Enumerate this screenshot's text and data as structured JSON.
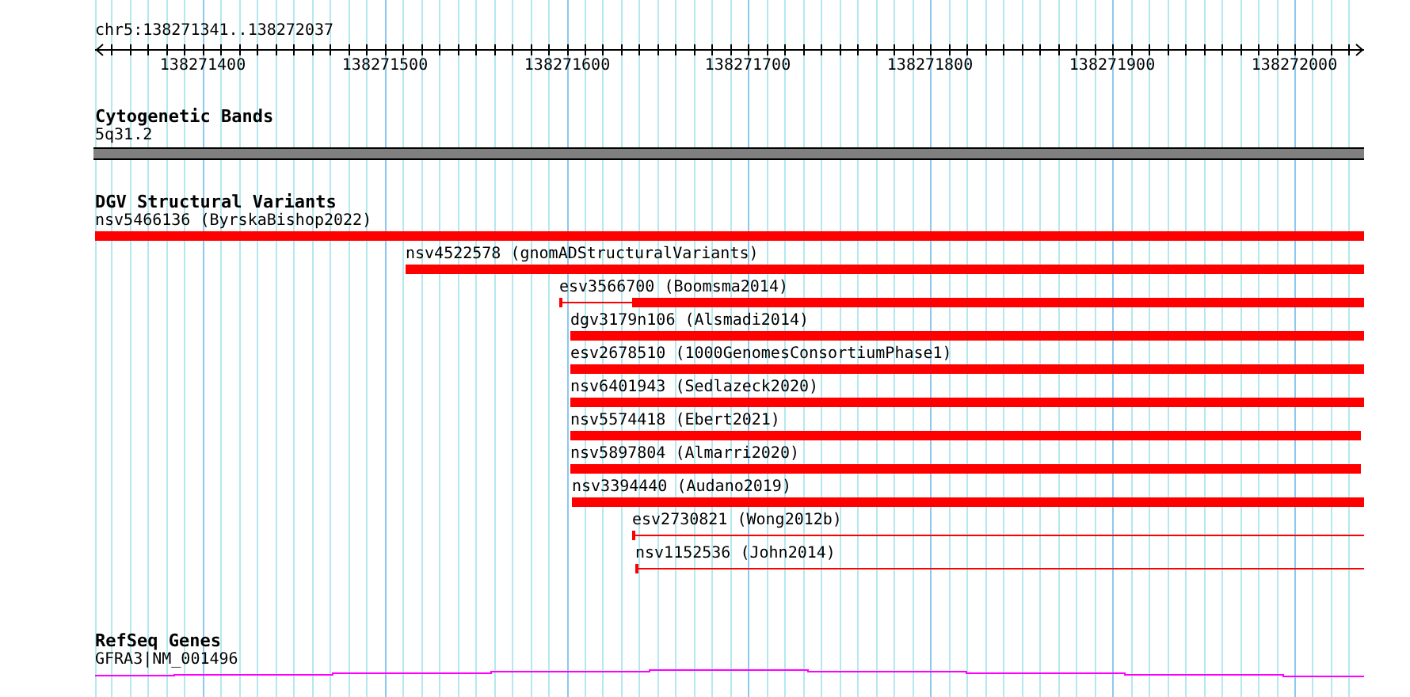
{
  "location": "chr5:138271341..138272037",
  "axis": {
    "ticks": [
      "138271400",
      "138271500",
      "138271600",
      "138271700",
      "138271800",
      "138271900",
      "138272000"
    ]
  },
  "tracks": [
    {
      "kind": "cytoband",
      "title": "Cytogenetic Bands",
      "features": [
        {
          "label": "5q31.2"
        }
      ]
    },
    {
      "kind": "variants",
      "title": "DGV Structural Variants",
      "features": [
        {
          "label": "nsv5466136 (ByrskaBishop2022)",
          "kind": "thick"
        },
        {
          "label": "nsv4522578 (gnomADStructuralVariants)",
          "kind": "thick"
        },
        {
          "label": "esv3566700 (Boomsma2014)",
          "kind": "split"
        },
        {
          "label": "dgv3179n106 (Alsmadi2014)",
          "kind": "thick"
        },
        {
          "label": "esv2678510 (1000GenomesConsortiumPhase1)",
          "kind": "thick"
        },
        {
          "label": "nsv6401943 (Sedlazeck2020)",
          "kind": "thick"
        },
        {
          "label": "nsv5574418 (Ebert2021)",
          "kind": "thick"
        },
        {
          "label": "nsv5897804 (Almarri2020)",
          "kind": "thick"
        },
        {
          "label": "nsv3394440 (Audano2019)",
          "kind": "thick"
        },
        {
          "label": "esv2730821 (Wong2012b)",
          "kind": "thin"
        },
        {
          "label": "nsv1152536 (John2014)",
          "kind": "thin"
        }
      ]
    },
    {
      "kind": "genes",
      "title": "RefSeq Genes",
      "features": [
        {
          "label": "GFRA3|NM_001496"
        }
      ]
    }
  ]
}
